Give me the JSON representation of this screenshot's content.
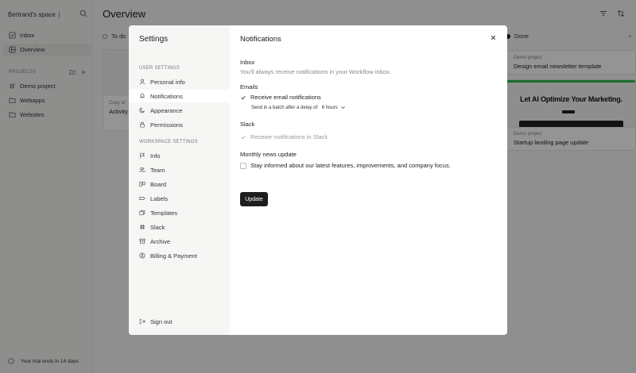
{
  "sidebar": {
    "workspace": "Bertrand's space",
    "nav": [
      {
        "label": "Inbox",
        "icon": "inbox-icon"
      },
      {
        "label": "Overview",
        "icon": "overview-icon"
      }
    ],
    "projects_heading": "PROJECTS",
    "projects": [
      {
        "label": "Demo project",
        "icon": "hash-icon"
      },
      {
        "label": "Webapps",
        "icon": "folder-icon"
      },
      {
        "label": "Websites",
        "icon": "folder-icon"
      }
    ],
    "trial": "Your trial ends in 14 days"
  },
  "main": {
    "title": "Overview",
    "columns": [
      {
        "label": "To do",
        "color": "#888888"
      },
      {
        "label": "Done",
        "color": "#1e1e1e"
      }
    ],
    "left_card": {
      "meta": "Copy of",
      "title": "Activity"
    },
    "cards": [
      {
        "meta": "Demo project",
        "title": "Design email newsletter template"
      },
      {
        "meta": "Demo project",
        "title": "Startup landing page update",
        "hero": "Let AI Optimize Your Marketing."
      }
    ]
  },
  "settings": {
    "title": "Settings",
    "user_section": "USER SETTINGS",
    "user_items": [
      {
        "label": "Personal info",
        "icon": "user-icon"
      },
      {
        "label": "Notifications",
        "icon": "bell-icon"
      },
      {
        "label": "Appearance",
        "icon": "moon-icon"
      },
      {
        "label": "Permissions",
        "icon": "lock-icon"
      }
    ],
    "workspace_section": "WORKSPACE SETTINGS",
    "workspace_items": [
      {
        "label": "Info",
        "icon": "flag-icon"
      },
      {
        "label": "Team",
        "icon": "team-icon"
      },
      {
        "label": "Board",
        "icon": "board-icon"
      },
      {
        "label": "Labels",
        "icon": "tag-icon"
      },
      {
        "label": "Templates",
        "icon": "templates-icon"
      },
      {
        "label": "Slack",
        "icon": "slack-icon"
      },
      {
        "label": "Archive",
        "icon": "archive-icon"
      },
      {
        "label": "Billing & Payment",
        "icon": "billing-icon"
      }
    ],
    "sign_out": "Sign out"
  },
  "notifications": {
    "heading": "Notifications",
    "inbox_label": "Inbox",
    "inbox_text": "You'll always receive notifications in your Workflow inbox.",
    "emails_label": "Emails",
    "emails_checkbox": "Receive email notifications",
    "emails_checked": true,
    "delay_label": "Send in a batch after a delay of:",
    "delay_value": "6 hours",
    "slack_label": "Slack",
    "slack_checkbox": "Receive notifications in Slack",
    "slack_checked": true,
    "news_label": "Monthly news update",
    "news_checkbox": "Stay informed about our latest features, improvements, and company focus.",
    "news_checked": false,
    "update_button": "Update"
  }
}
